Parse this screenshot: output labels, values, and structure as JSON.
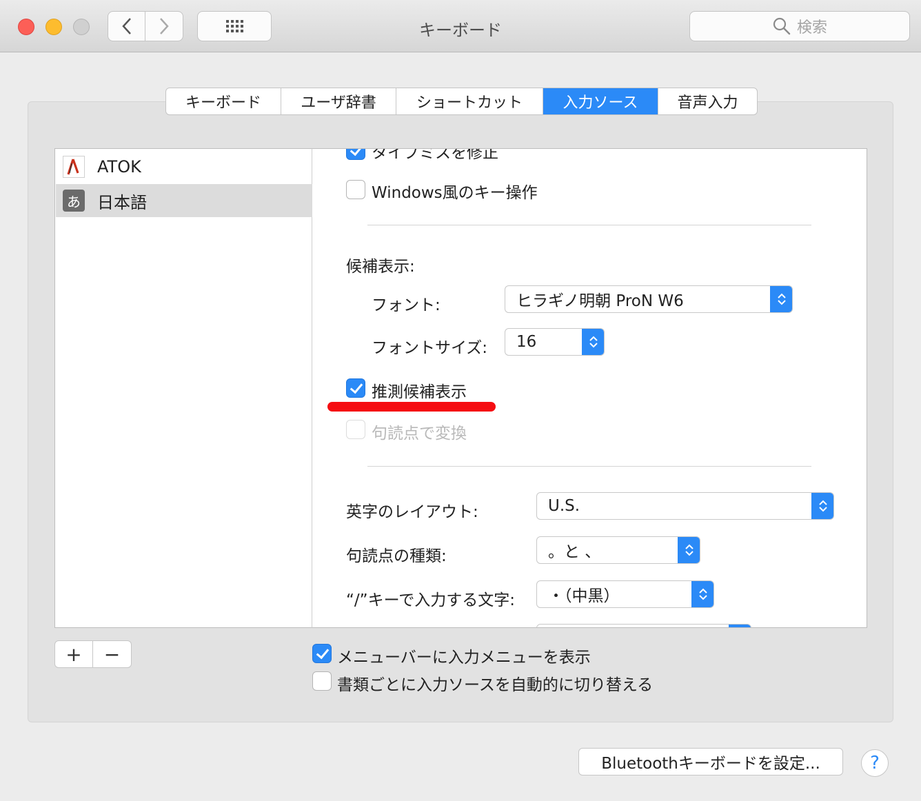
{
  "window": {
    "title": "キーボード"
  },
  "search": {
    "placeholder": "検索"
  },
  "tabs": [
    {
      "label": "キーボード",
      "active": false
    },
    {
      "label": "ユーザ辞書",
      "active": false
    },
    {
      "label": "ショートカット",
      "active": false
    },
    {
      "label": "入力ソース",
      "active": true
    },
    {
      "label": "音声入力",
      "active": false
    }
  ],
  "sources": [
    {
      "label": "ATOK",
      "icon": "atok-icon",
      "selected": false
    },
    {
      "label": "日本語",
      "icon": "japanese-hiragana-icon",
      "icon_glyph": "あ",
      "selected": true
    }
  ],
  "options": {
    "cut_off_checkbox_label": "タイプミスを修正",
    "windows_keys_label": "Windows風のキー操作",
    "windows_keys_checked": false,
    "candidates_heading": "候補表示:",
    "font_label": "フォント:",
    "font_value": "ヒラギノ明朝 ProN W6",
    "font_size_label": "フォントサイズ:",
    "font_size_value": "16",
    "predictive_label": "推測候補表示",
    "predictive_checked": true,
    "punct_convert_label": "句読点で変換",
    "punct_convert_checked": false,
    "layout_label": "英字のレイアウト:",
    "layout_value": "U.S.",
    "punct_type_label": "句読点の種類:",
    "punct_type_value": "。と 、",
    "slash_label": "“/”キーで入力する文字:",
    "slash_value": "・（中黒）"
  },
  "bottom": {
    "add_label": "+",
    "remove_label": "−",
    "show_menu_label": "メニューバーに入力メニューを表示",
    "show_menu_checked": true,
    "auto_switch_label": "書類ごとに入力ソースを自動的に切り替える",
    "auto_switch_checked": false,
    "bluetooth_button": "Bluetoothキーボードを設定...",
    "help_label": "?"
  },
  "colors": {
    "accent": "#2b8af7",
    "highlight_mark": "#f50d12"
  }
}
